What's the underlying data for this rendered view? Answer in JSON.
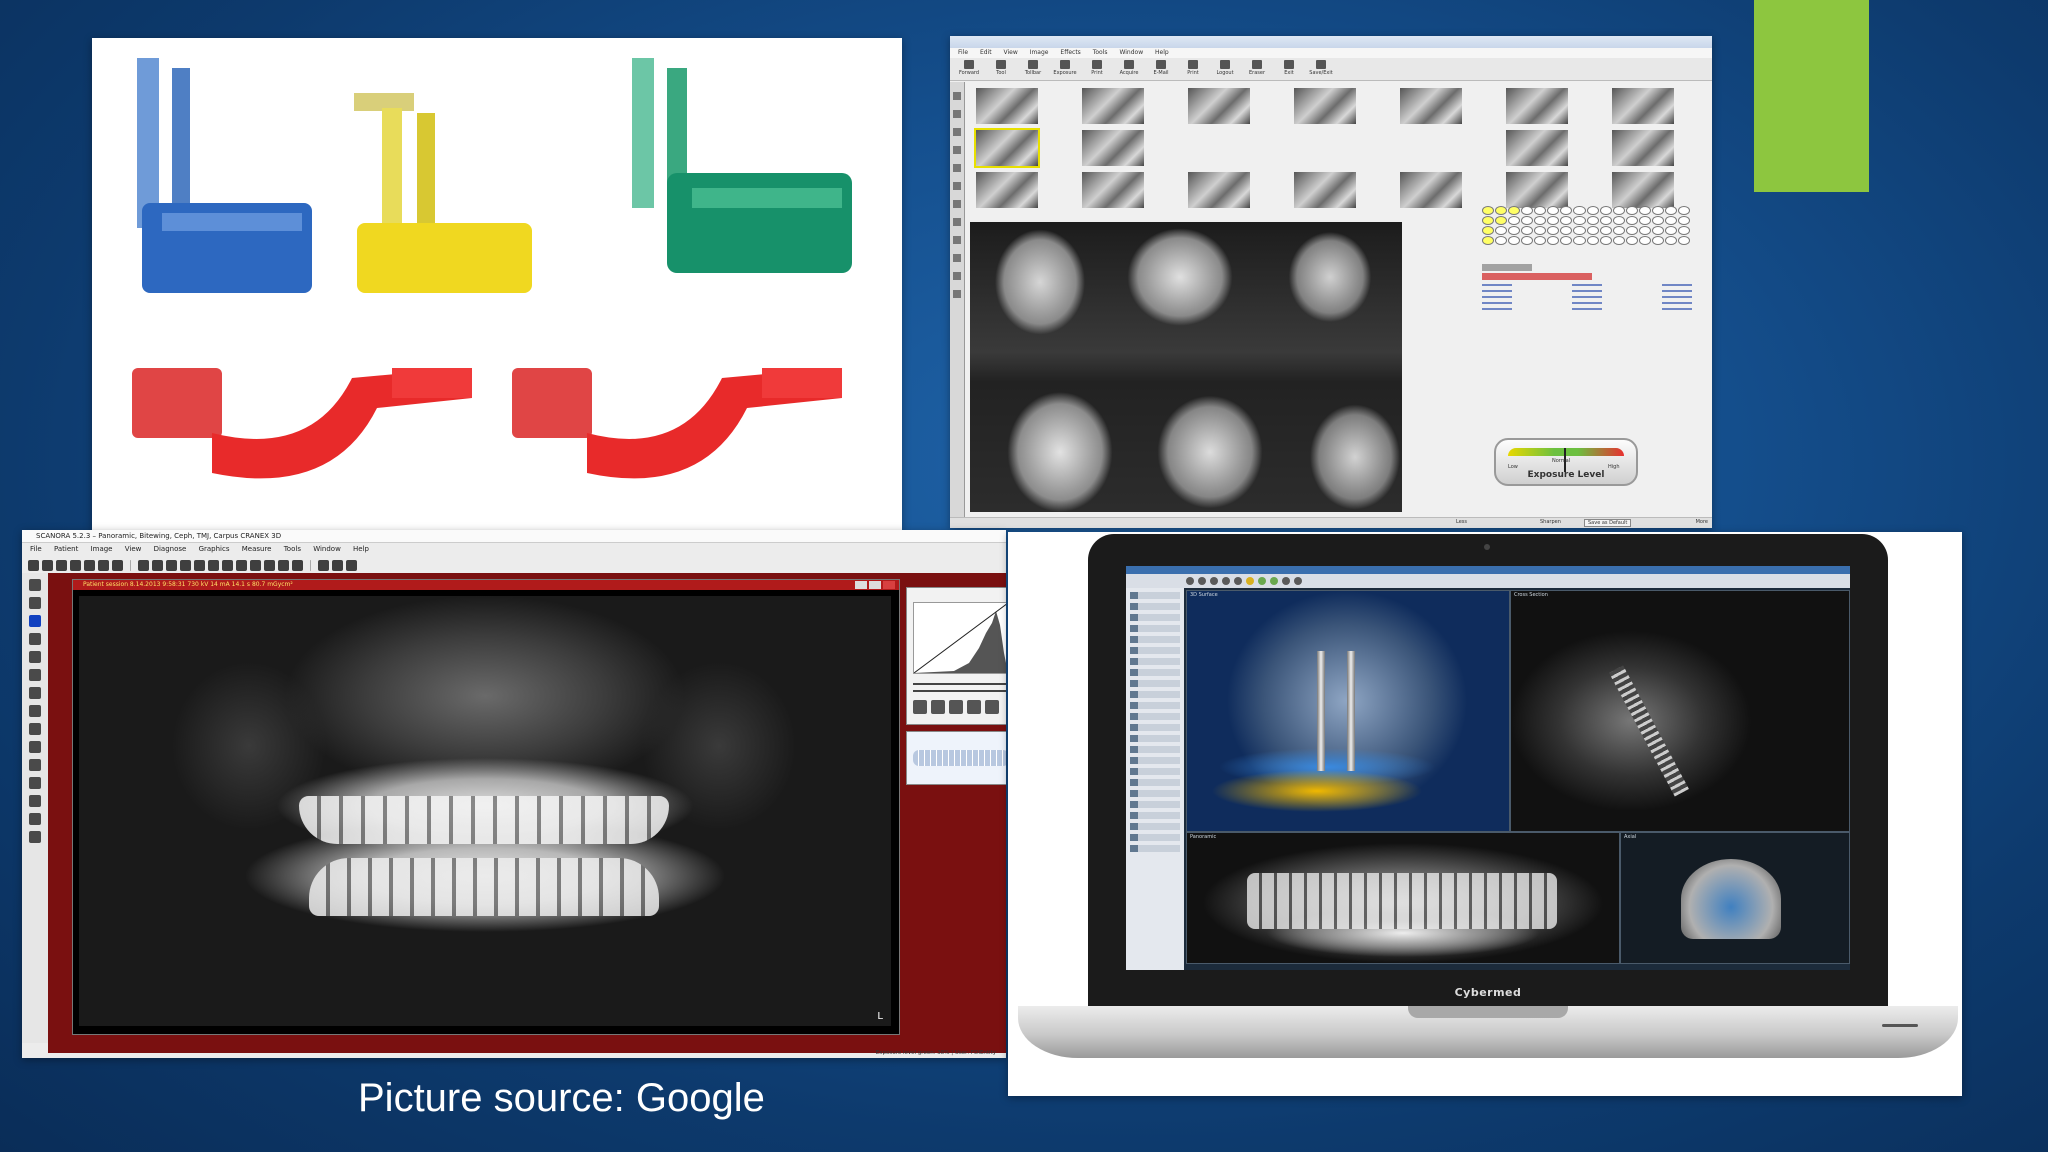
{
  "slide": {
    "caption": "Picture source: Google",
    "accent_color": "#8dc63f"
  },
  "film_holders": {
    "colors": [
      "#3a6fc4",
      "#e6d33a",
      "#1f9a6a",
      "#e23a3a",
      "#e23a3a"
    ]
  },
  "imaging_app": {
    "menu": [
      "File",
      "Edit",
      "View",
      "Image",
      "Effects",
      "Tools",
      "Window",
      "Help"
    ],
    "toolbar": [
      "Forward",
      "Tool",
      "Tollbar",
      "Exposure",
      "Print",
      "Acquire",
      "E-Mail",
      "Print",
      "Logout",
      "Eraser",
      "Exit",
      "Save/Exit"
    ],
    "gauge": {
      "title": "Exposure Level",
      "low": "Low",
      "normal": "Normal",
      "high": "High"
    },
    "status": {
      "save_btn": "Save as Default",
      "left": "Less",
      "mid": "Sharpen",
      "right": "More"
    }
  },
  "pano_app": {
    "title": "SCANORA 5.2.3 – Panoramic, Bitewing, Ceph, TMJ, Carpus CRANEX 3D",
    "menu": [
      "File",
      "Patient",
      "Image",
      "View",
      "Diagnose",
      "Graphics",
      "Measure",
      "Tools",
      "Window",
      "Help"
    ],
    "image_window_title": "Patient session  8.14.2013 9:58:31  730 kV 14 mA 14.1 s 80.7 mGycm²",
    "side_mark": "L",
    "status": "Exposure level  green: 38%  |  User: FDIEntity"
  },
  "laptop": {
    "brand": "Cybermed",
    "views": {
      "v3d": "3D Surface",
      "sag": "Cross Section",
      "pan": "Panoramic",
      "axial": "Axial"
    }
  }
}
